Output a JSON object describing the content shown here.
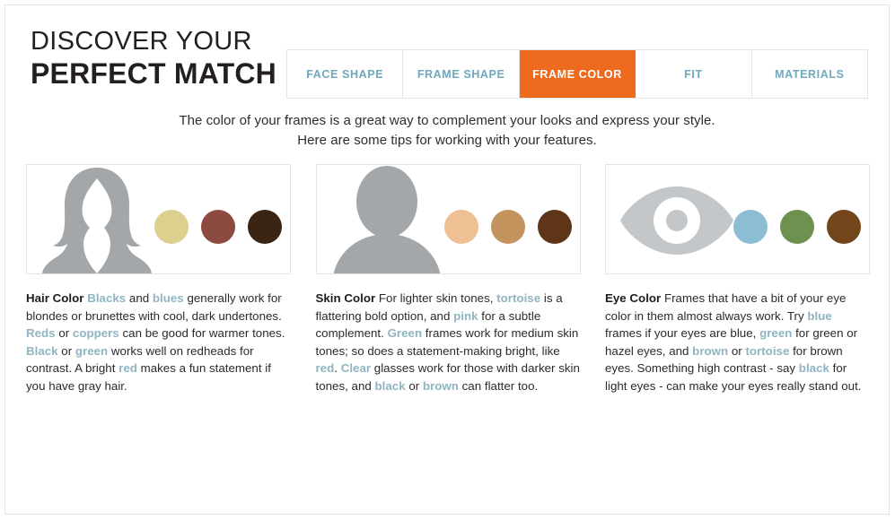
{
  "header": {
    "title_line1": "DISCOVER YOUR",
    "title_line2": "PERFECT MATCH"
  },
  "tabs": {
    "items": [
      {
        "label": "FACE SHAPE",
        "active": false
      },
      {
        "label": "FRAME SHAPE",
        "active": false
      },
      {
        "label": "FRAME COLOR",
        "active": true
      },
      {
        "label": "FIT",
        "active": false
      },
      {
        "label": "MATERIALS",
        "active": false
      }
    ],
    "active_color": "#ee6a1e",
    "inactive_color": "#6fa8be"
  },
  "intro": {
    "line1": "The color of your frames is a great way to complement your looks and express your style.",
    "line2": "Here are some tips for working with your features."
  },
  "cards": [
    {
      "id": "hair-color",
      "heading": "Hair Color",
      "figure_icon": "woman-silhouette-icon",
      "silhouette_color": "#a3a7aa",
      "swatches": [
        {
          "name": "blonde-swatch",
          "color": "#ddcf8d"
        },
        {
          "name": "auburn-swatch",
          "color": "#8d4a41"
        },
        {
          "name": "dark-brown-swatch",
          "color": "#3a2413"
        }
      ],
      "body_parts": [
        {
          "t": "Hair Color ",
          "s": "bold"
        },
        {
          "t": "Blacks",
          "s": "hl"
        },
        {
          "t": " and ",
          "s": ""
        },
        {
          "t": "blues",
          "s": "hl"
        },
        {
          "t": " generally work for blondes or brunettes with cool, dark undertones. ",
          "s": ""
        },
        {
          "t": "Reds",
          "s": "hl"
        },
        {
          "t": " or ",
          "s": ""
        },
        {
          "t": "coppers",
          "s": "hl"
        },
        {
          "t": " can be good for warmer tones. ",
          "s": ""
        },
        {
          "t": "Black",
          "s": "hl"
        },
        {
          "t": " or ",
          "s": ""
        },
        {
          "t": "green",
          "s": "hl"
        },
        {
          "t": " works well on redheads for contrast. A bright ",
          "s": ""
        },
        {
          "t": "red",
          "s": "hl"
        },
        {
          "t": " makes a fun statement if you have gray hair.",
          "s": ""
        }
      ]
    },
    {
      "id": "skin-color",
      "heading": "Skin Color",
      "figure_icon": "person-silhouette-icon",
      "silhouette_color": "#a3a7aa",
      "swatches": [
        {
          "name": "light-skin-swatch",
          "color": "#eec094"
        },
        {
          "name": "medium-skin-swatch",
          "color": "#c4945e"
        },
        {
          "name": "dark-skin-swatch",
          "color": "#5e3518"
        }
      ],
      "body_parts": [
        {
          "t": "Skin Color ",
          "s": "bold"
        },
        {
          "t": "For lighter skin tones, ",
          "s": ""
        },
        {
          "t": "tortoise",
          "s": "hl"
        },
        {
          "t": " is a flattering bold option, and ",
          "s": ""
        },
        {
          "t": "pink",
          "s": "hl"
        },
        {
          "t": " for a subtle complement. ",
          "s": ""
        },
        {
          "t": "Green",
          "s": "hl"
        },
        {
          "t": " frames work for medium skin tones; so does a statement-making bright, like ",
          "s": ""
        },
        {
          "t": "red",
          "s": "hl"
        },
        {
          "t": ". ",
          "s": ""
        },
        {
          "t": "Clear",
          "s": "hl"
        },
        {
          "t": " glasses work for those with darker skin tones, and ",
          "s": ""
        },
        {
          "t": "black",
          "s": "hl"
        },
        {
          "t": " or ",
          "s": ""
        },
        {
          "t": "brown",
          "s": "hl"
        },
        {
          "t": " can flatter too.",
          "s": ""
        }
      ]
    },
    {
      "id": "eye-color",
      "heading": "Eye Color",
      "figure_icon": "eye-icon",
      "silhouette_color": "#c3c7c9",
      "swatches": [
        {
          "name": "blue-eye-swatch",
          "color": "#8cbdd2"
        },
        {
          "name": "green-eye-swatch",
          "color": "#6f9150"
        },
        {
          "name": "brown-eye-swatch",
          "color": "#72451b"
        }
      ],
      "body_parts": [
        {
          "t": "Eye Color ",
          "s": "bold"
        },
        {
          "t": "Frames that have a bit of your eye color in them almost always work. Try ",
          "s": ""
        },
        {
          "t": "blue",
          "s": "hl"
        },
        {
          "t": " frames if your eyes are blue, ",
          "s": ""
        },
        {
          "t": "green",
          "s": "hl"
        },
        {
          "t": " for green or hazel eyes, and ",
          "s": ""
        },
        {
          "t": "brown",
          "s": "hl"
        },
        {
          "t": " or ",
          "s": ""
        },
        {
          "t": "tortoise",
          "s": "hl"
        },
        {
          "t": " for brown eyes. Something high contrast - say ",
          "s": ""
        },
        {
          "t": "black",
          "s": "hl"
        },
        {
          "t": " for light eyes - can make your eyes really stand out.",
          "s": ""
        }
      ]
    }
  ],
  "highlight_color": "#8fb4c2"
}
